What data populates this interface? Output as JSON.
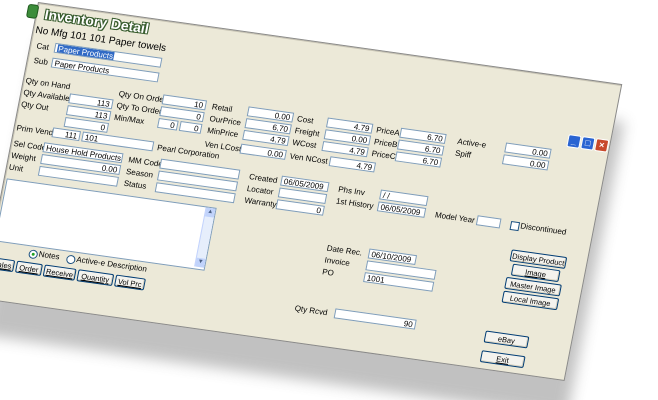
{
  "window": {
    "title": "Inventory Detail",
    "product_line": "No Mfg 101 101  Paper towels",
    "controls": [
      "minimize-icon",
      "maximize-icon",
      "close-icon"
    ]
  },
  "fields": {
    "cat_label": "Cat",
    "cat_value": "Paper Products",
    "sub_label": "Sub",
    "sub_value": "Paper Products",
    "qty_on_hand_label": "Qty on Hand",
    "qty_available_label": "Qty Available",
    "qty_available": "113",
    "qty_out_label": "Qty Out",
    "qty_out": "113",
    "prim_vend_label": "Prim Vend",
    "prim_vend_num": "0",
    "prim_vend_code": "111",
    "prim_vend_id": "101",
    "prim_vend_name": "Pearl Corporation",
    "qty_on_order_label": "Qty On Order",
    "qty_on_order": "10",
    "qty_to_order_label": "Qty To Order",
    "qty_to_order": "0",
    "min_max_label": "Min/Max",
    "min": "0",
    "max": "0",
    "retail_label": "Retail",
    "ourprice_label": "OurPrice",
    "ourprice": "0.00",
    "minprice_label": "MinPrice",
    "minprice": "6.70",
    "cost_label": "Cost",
    "cost": "4.79",
    "freight_label": "Freight",
    "freight": "0.00",
    "wcost_label": "WCost",
    "wcost": "4.79",
    "pricea_label": "PriceA",
    "pricea": "6.70",
    "priceb_label": "PriceB",
    "priceb": "6.70",
    "pricec_label": "PriceC",
    "pricec": "6.70",
    "active_e_label": "Active-e",
    "spiff_label": "Spiff",
    "spiff": "0.00",
    "spiff2": "0.00",
    "ven_lcost_label": "Ven LCost",
    "ven_lcost": "0.00",
    "ven_ncost_label": "Ven NCost",
    "ven_ncost": "4.79",
    "ven_extra": "4.79",
    "sel_code_label": "Sel Code",
    "sel_code": "House Hold Products",
    "weight_label": "Weight",
    "weight": "0.00",
    "unit_label": "Unit",
    "mm_code_label": "MM Code",
    "season_label": "Season",
    "status_label": "Status",
    "created_label": "Created",
    "created": "06/05/2009",
    "locator_label": "Locator",
    "warranty_label": "Warranty",
    "warranty": "0",
    "phs_inv_label": "Phs Inv",
    "phs_inv": "/ /",
    "first_history_label": "1st History",
    "first_history": "06/05/2009",
    "model_year_label": "Model Year",
    "discontinued_label": "Discontinued",
    "date_rec_label": "Date Rec.",
    "date_rec": "06/10/2009",
    "invoice_label": "Invoice",
    "po_label": "PO",
    "po": "1001",
    "qty_rcvd_label": "Qty Rcvd",
    "qty_rcvd": "90"
  },
  "notes": {
    "option_notes": "Notes",
    "option_active_e": "Active-e Description",
    "selected": "Notes"
  },
  "buttons": {
    "sales": "Sales",
    "order": "Order",
    "receive": "Receive",
    "quantity": "Quantity",
    "vol_prc": "Vol Prc",
    "display_product": "Display Product",
    "image": "Image",
    "master_image": "Master Image",
    "local_image": "Local Image",
    "ebay": "eBay",
    "exit": "Exit"
  },
  "colors": {
    "window_bg": "#ece9d8",
    "field_border": "#7f9db9",
    "selection": "#316ac5",
    "title_text": "#ffffff",
    "close_btn": "#c8492a",
    "xp_blue": "#2a64d2"
  }
}
